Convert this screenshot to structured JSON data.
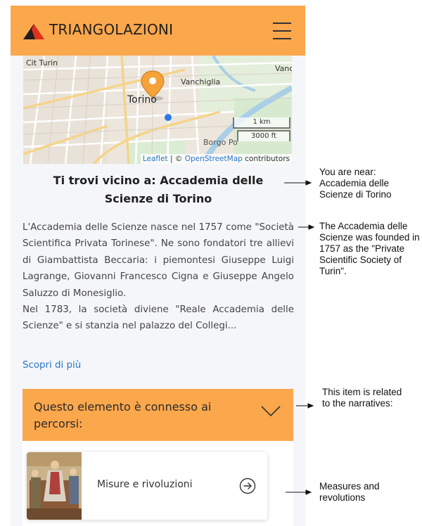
{
  "header": {
    "brand": "TRIANGOLAZIONI",
    "logo_icon": "red-triangle-logo-icon",
    "menu_icon": "hamburger-menu-icon",
    "accent_color": "#fba74c"
  },
  "map": {
    "labels": {
      "cit_turin": "Cit Turin",
      "torino": "Torino",
      "vanchiglia": "Vanchiglia",
      "vanc": "Vanc",
      "borgo": "Borgo Po"
    },
    "scale_km": "1 km",
    "scale_ft": "3000 ft",
    "attribution": {
      "leaflet": "Leaflet",
      "sep": " | © ",
      "osm": "OpenStreetMap",
      "suffix": " contributors"
    }
  },
  "content": {
    "title": "Ti trovi vicino a: Accademia delle Scienze di Torino",
    "paragraph1": "L'Accademia delle Scienze nasce nel 1757 come \"Società Scientifica Privata Torinese\". Ne sono fondatori tre allievi di Giambattista Beccaria: i piemontesi Giuseppe Luigi Lagrange, Giovanni Francesco Cigna e Giuseppe Angelo Saluzzo di Monesiglio.",
    "paragraph2": "Nel 1783, la società diviene \"Reale Accademia delle Scienze\" e si stanzia nel palazzo del Collegi...",
    "more_link": "Scopri di più"
  },
  "accordion": {
    "label": "Questo elemento è connesso ai percorsi:",
    "chevron_icon": "chevron-down-icon"
  },
  "narratives": [
    {
      "label": "Misure e rivoluzioni",
      "arrow_icon": "circle-arrow-right-icon"
    }
  ],
  "annotations": {
    "near": "You are near: Accademia delle Scienze di Torino",
    "founded": "The Accademia delle Scienze was founded in 1757 as the \"Private Scientific Society of Turin\".",
    "related": "This item is related to the narratives:",
    "measures": "Measures and revolutions"
  }
}
